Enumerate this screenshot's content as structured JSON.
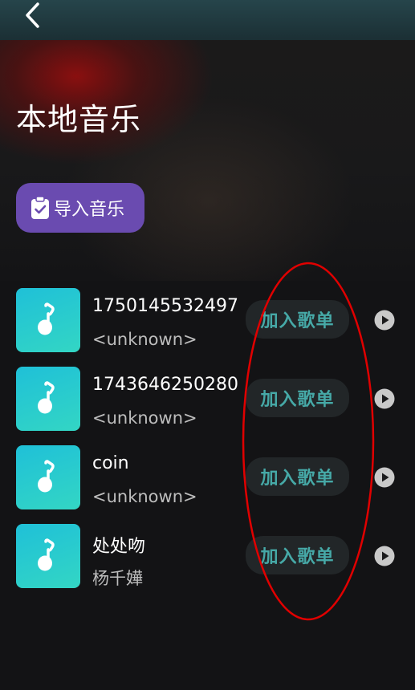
{
  "header": {
    "back_icon": "chevron-left-icon",
    "title": "本地音乐"
  },
  "import_button": {
    "icon": "clipboard-check-icon",
    "label": "导入音乐",
    "color": "#6a4bb0"
  },
  "songs": [
    {
      "title": "1750145532497",
      "artist": "<unknown>",
      "add_label": "加入歌单"
    },
    {
      "title": "1743646250280",
      "artist": "<unknown>",
      "add_label": "加入歌单"
    },
    {
      "title": "coin",
      "artist": "<unknown>",
      "add_label": "加入歌单"
    },
    {
      "title": "处处吻",
      "artist": "杨千嬅",
      "add_label": "加入歌单"
    }
  ],
  "colors": {
    "accent": "#46a9a7",
    "cover_gradient_start": "#1fc0d8",
    "cover_gradient_end": "#33d6c4",
    "annotation": "#e00000"
  }
}
